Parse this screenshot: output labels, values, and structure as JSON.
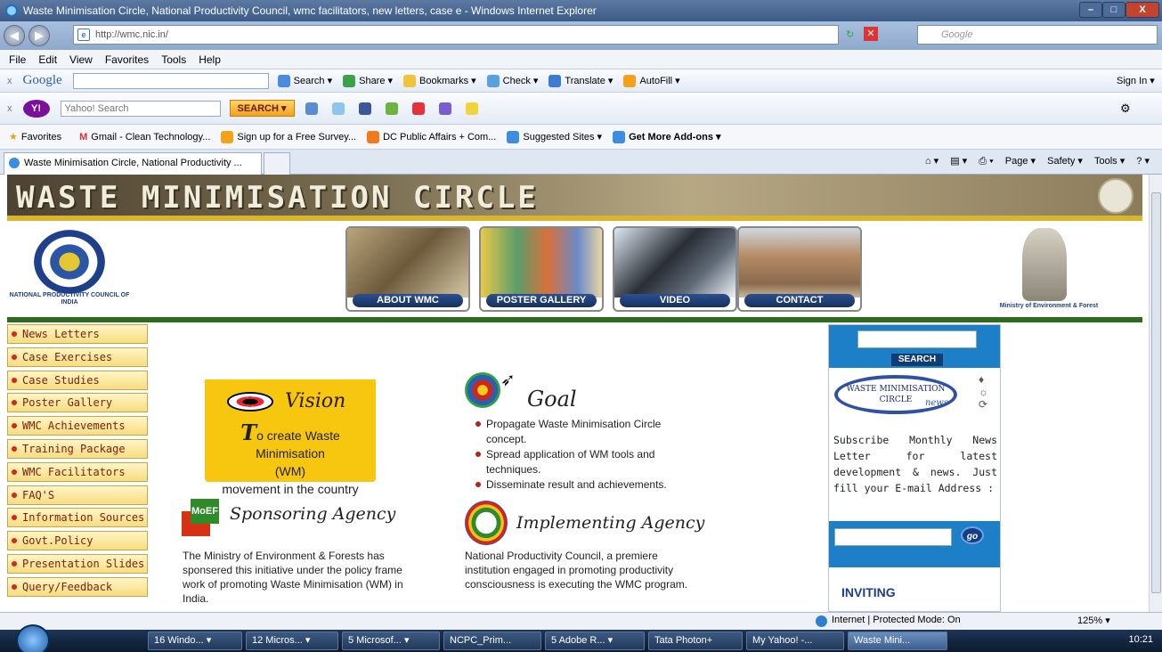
{
  "window": {
    "title": "Waste Minimisation Circle, National Productivity Council, wmc facilitators, new letters, case e - Windows Internet Explorer",
    "minimize": "–",
    "maximize": "□",
    "close": "X"
  },
  "address": {
    "url": "http://wmc.nic.in/",
    "search_placeholder": "Google"
  },
  "menu": [
    "File",
    "Edit",
    "View",
    "Favorites",
    "Tools",
    "Help"
  ],
  "google_toolbar": {
    "brand": "Google",
    "items": [
      "Search ▾",
      "Share ▾",
      "Bookmarks ▾",
      "Check ▾",
      "Translate ▾",
      "AutoFill ▾"
    ],
    "sign_in": "Sign In ▾"
  },
  "yahoo_toolbar": {
    "brand": "Y!",
    "placeholder": "Yahoo! Search",
    "search_btn": "SEARCH ▾"
  },
  "favorites_bar": {
    "favorites": "Favorites",
    "items": [
      "Gmail - Clean Technology...",
      "Sign up for a Free Survey...",
      "DC Public Affairs + Com...",
      "Suggested Sites ▾",
      "Get More Add-ons ▾"
    ]
  },
  "tabs": {
    "active": "Waste Minimisation Circle, National Productivity ...",
    "commands": [
      "Page ▾",
      "Safety ▾",
      "Tools ▾"
    ]
  },
  "page": {
    "banner_title": "WASTE MINIMISATION CIRCLE",
    "npc_name": "NATIONAL PRODUCTIVITY COUNCIL OF INDIA",
    "moef_name": "Ministry of Environment & Forest",
    "nav": [
      "ABOUT WMC",
      "POSTER GALLERY",
      "VIDEO",
      "CONTACT"
    ],
    "left_menu": [
      "News Letters",
      "Case Exercises",
      "Case Studies",
      "Poster Gallery",
      "WMC Achievements",
      "Training Package",
      "WMC Facilitators",
      "FAQ'S",
      "Information Sources",
      "Govt.Policy",
      "Presentation Slides",
      "Query/Feedback"
    ],
    "vision": {
      "title": "Vision",
      "initial": "T",
      "line1": "o create Waste Minimisation",
      "line2": "(WM)",
      "line3": "movement in the country"
    },
    "goal": {
      "title": "Goal",
      "items": [
        "Propagate Waste Minimisation Circle concept.",
        "Spread application of WM tools and techniques.",
        "Disseminate result and achievements."
      ]
    },
    "sponsoring": {
      "logo": "MoEF",
      "title": "Sponsoring Agency",
      "text": "The Ministry of Environment & Forests has sponsered this initiative under the policy frame work of promoting Waste Minimisation (WM) in India."
    },
    "implementing": {
      "title": "Implementing Agency",
      "text": "National Productivity Council, a premiere institution engaged in promoting productivity consciousness is executing the WMC program."
    },
    "right_panel": {
      "search_btn": "SEARCH",
      "news_logo_line1": "WASTE MINIMISATION",
      "news_logo_line2": "CIRCLE",
      "news_logo_word": "news",
      "subscribe_text": "Subscribe Monthly News Letter for latest development & news. Just fill your E-mail Address :",
      "go_btn": "go",
      "inviting": "INVITING"
    }
  },
  "status": {
    "zone": "Internet | Protected Mode: On",
    "zoom": "125% ▾"
  },
  "taskbar": {
    "buttons": [
      "16 Windo... ▾",
      "12 Micros... ▾",
      "5 Microsof... ▾",
      "NCPC_Prim...",
      "5 Adobe R... ▾",
      "Tata Photon+",
      "My Yahoo! -...",
      "Waste Mini..."
    ],
    "clock": "10:21"
  }
}
